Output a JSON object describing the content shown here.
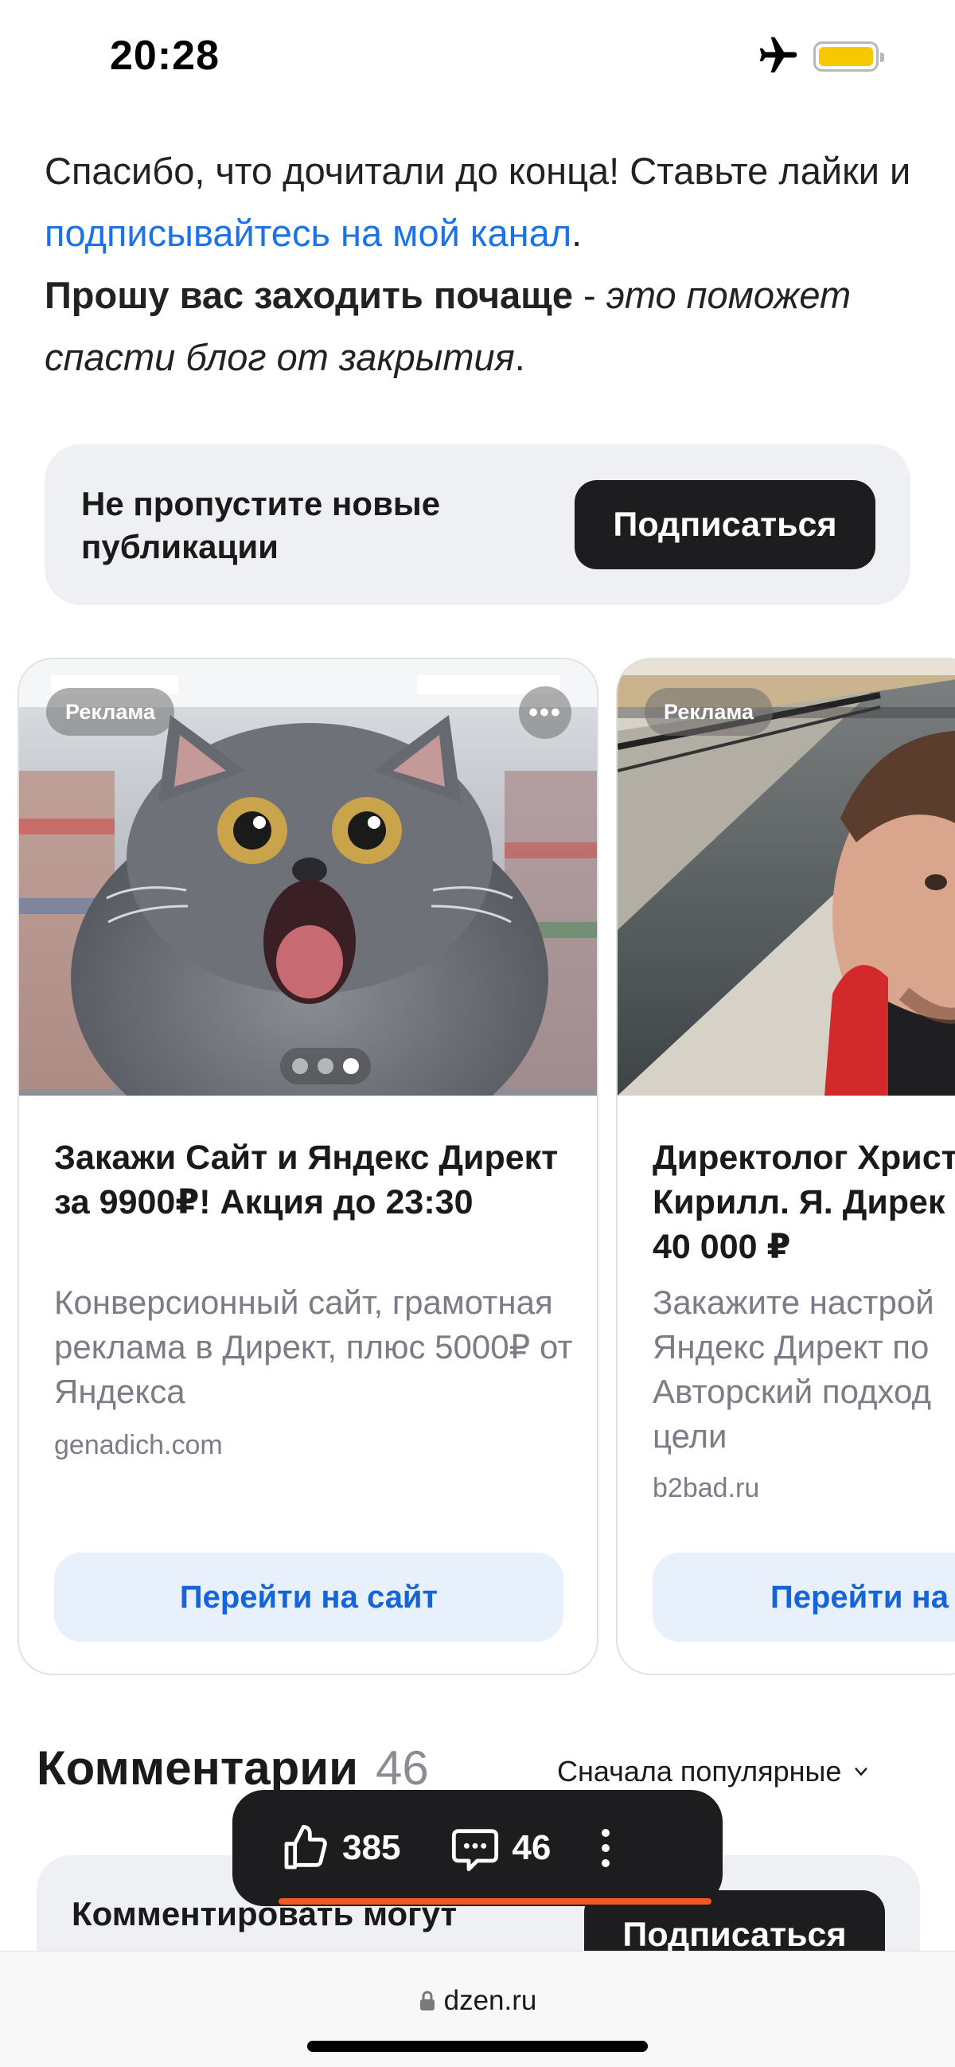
{
  "status_bar": {
    "time": "20:28",
    "icons": [
      "airplane-icon",
      "battery-icon"
    ],
    "battery_color": "#f7c800"
  },
  "article_end": {
    "line1_prefix": "Спасибо, что дочитали до конца! Ставьте лайки и ",
    "link_text": "подписывайтесь на мой канал",
    "line1_suffix": ".",
    "bold_text": "Прошу вас заходить почаще",
    "dash": " - ",
    "italic_text": "это поможет спасти блог от закрытия",
    "end_dot": "."
  },
  "subscribe_box": {
    "text": "Не пропустите новые публикации",
    "button_label": "Подписаться"
  },
  "ads": [
    {
      "badge": "Реклама",
      "more_label": "•••",
      "image": "cat-photo",
      "dots_total": 3,
      "dots_active": 3,
      "title": "Закажи Сайт и Яндекс Директ за 9900₽! Акция до 23:30",
      "description": "Конверсионный сайт, грамотная реклама в Директ, плюс 5000₽ от Яндекса",
      "domain": "genadich.com",
      "button_label": "Перейти на сайт"
    },
    {
      "badge": "Реклама",
      "image": "canal-selfie-photo",
      "title": "Директолог Христ Кирилл. Я. Дирек от 40 000 ₽",
      "description": "Закажите настрой Яндекс Директ по Авторский подход цели",
      "domain": "b2bad.ru",
      "button_label": "Перейти на"
    }
  ],
  "comments": {
    "title": "Комментарии",
    "count": "46",
    "sort_label": "Сначала популярные",
    "box_text": "Комментировать могут",
    "box_button": "Подписаться"
  },
  "action_bar": {
    "likes": "385",
    "comments": "46",
    "accent_color": "#f05a22"
  },
  "browser": {
    "url": "dzen.ru"
  }
}
